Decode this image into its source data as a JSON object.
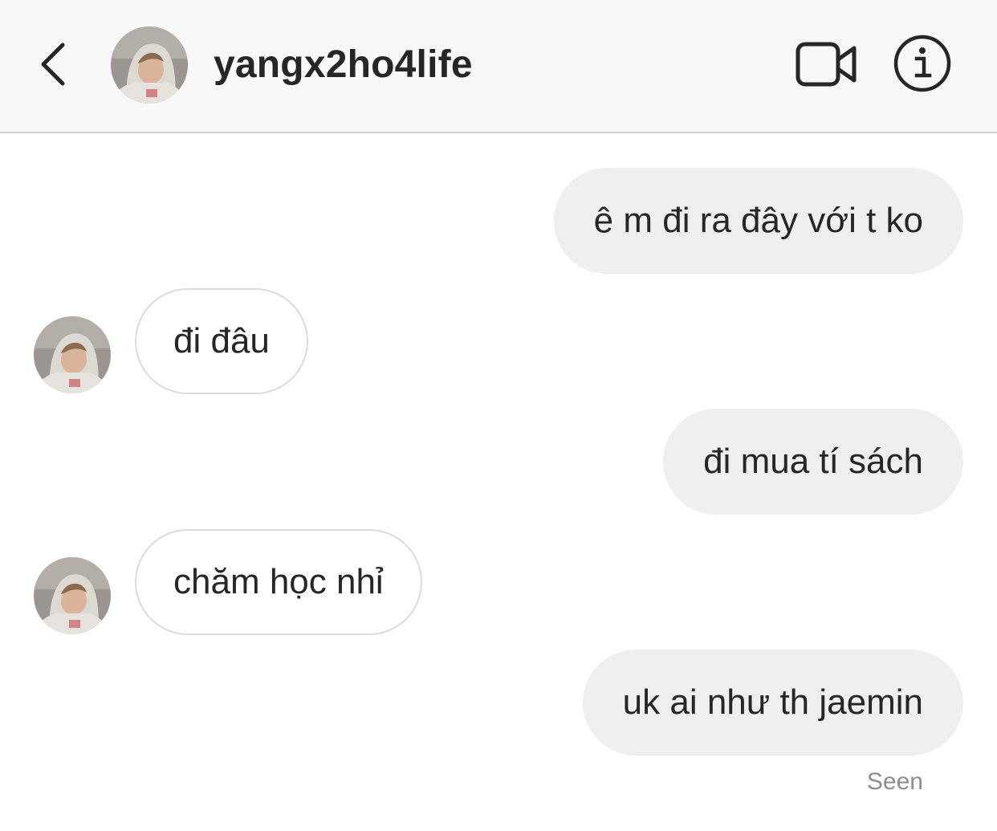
{
  "header": {
    "username": "yangx2ho4life",
    "back_icon": "chevron-left-icon",
    "video_icon": "video-camera-icon",
    "info_icon": "info-icon"
  },
  "messages": [
    {
      "direction": "sent",
      "text": "ê m đi ra đây với t ko"
    },
    {
      "direction": "received",
      "text": "đi đâu"
    },
    {
      "direction": "sent",
      "text": "đi mua tí sách"
    },
    {
      "direction": "received",
      "text": "chăm học nhỉ"
    },
    {
      "direction": "sent",
      "text": "uk ai như th jaemin"
    }
  ],
  "status": {
    "seen_label": "Seen"
  },
  "colors": {
    "header_bg": "#f8f8f8",
    "sent_bubble": "#efefef",
    "received_border": "#dbdbdb",
    "text": "#262626",
    "muted": "#8e8e8e"
  }
}
